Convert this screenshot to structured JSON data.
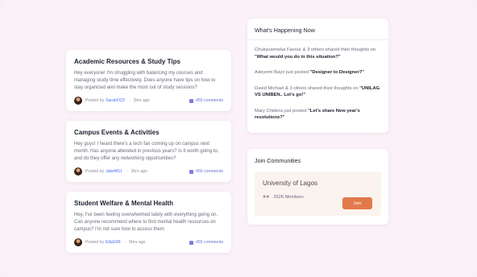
{
  "posts": [
    {
      "title": "Academic Resources & Study Tips",
      "body": "Hey everyone! I'm struggling with balancing my courses and managing study time effectively. Does anyone have tips on how to stay organized and make the most out of study sessions?",
      "posted_by_label": "Posted by",
      "author": "SarahO23",
      "time": "2hrs ago",
      "comments": "455 comments"
    },
    {
      "title": "Campus Events & Activities",
      "body": "Hey guys! I heard there's a tech fair coming up on campus next month. Has anyone attended in previous years? Is it worth going to, and do they offer any networking opportunities?",
      "posted_by_label": "Posted by",
      "author": "JakeM11",
      "time": "3hrs ago",
      "comments": "466 comments"
    },
    {
      "title": "Student Welfare & Mental Health",
      "body": "Hey, I've been feeling overwhelmed lately with everything going on. Can anyone recommend where to find mental health resources on campus? I'm not sure how to access them",
      "posted_by_label": "Posted by",
      "author": "EllaG99",
      "time": "5hrs ago",
      "comments": "455 comments"
    }
  ],
  "happening": {
    "title": "What's Happening Now",
    "items": [
      {
        "text": "Chukwuemeka Favour & 3 others shared their thoughts on ",
        "highlight": "\"What would you do in this situation?\""
      },
      {
        "text": "Adeyemi Bayo just posted ",
        "highlight": "\"Designer to Designer?\""
      },
      {
        "text": "David Michael & 3 others shared their thoughts on ",
        "highlight": "\"UNILAG VS UNIBEN.. Let's go!\""
      },
      {
        "text": "Mary Chidera just posted ",
        "highlight": "\"Let's share New year's resolutions?\""
      }
    ]
  },
  "communities": {
    "title": "Join Communities",
    "community_name": "University of Lagos",
    "members": "262K Members",
    "join_label": "Join"
  },
  "icons": {
    "comment": "comment-icon",
    "people": "people-icon",
    "avatar": "avatar"
  }
}
